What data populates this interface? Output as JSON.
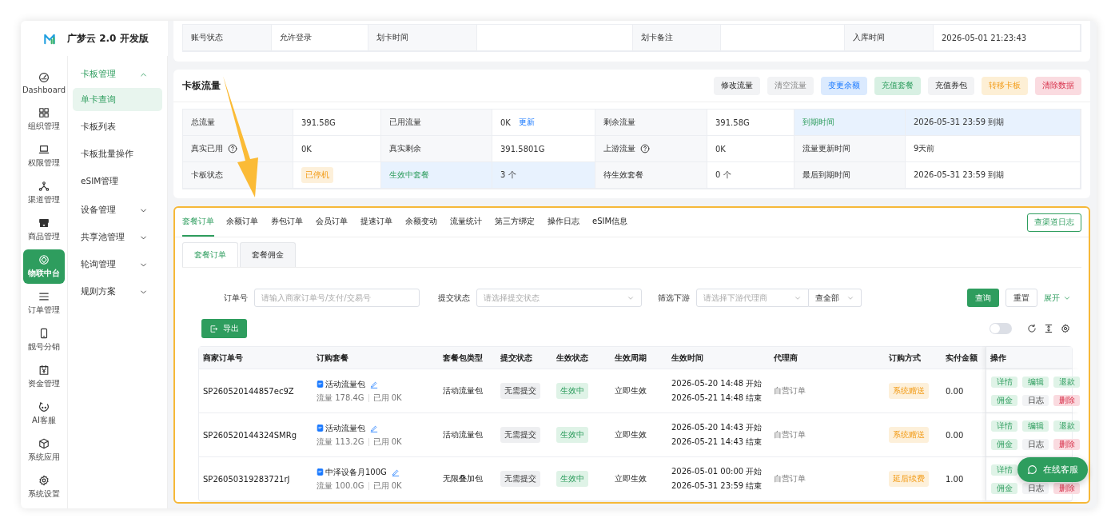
{
  "app": {
    "name": "广梦云 2.0 开发版"
  },
  "nav_rail": [
    {
      "label": "Dashboard",
      "selected": false
    },
    {
      "label": "组织管理",
      "selected": false
    },
    {
      "label": "权限管理",
      "selected": false
    },
    {
      "label": "渠道管理",
      "selected": false
    },
    {
      "label": "商品管理",
      "selected": false
    },
    {
      "label": "物联中台",
      "selected": true
    },
    {
      "label": "订单管理",
      "selected": false
    },
    {
      "label": "靓号分销",
      "selected": false
    },
    {
      "label": "资金管理",
      "selected": false
    },
    {
      "label": "AI客服",
      "selected": false
    },
    {
      "label": "系统应用",
      "selected": false
    },
    {
      "label": "系统设置",
      "selected": false
    }
  ],
  "submenu": [
    {
      "label": "卡板管理",
      "expanded": true,
      "children": [
        {
          "label": "单卡查询",
          "selected": true
        },
        {
          "label": "卡板列表",
          "selected": false
        },
        {
          "label": "卡板批量操作",
          "selected": false
        },
        {
          "label": "eSIM管理",
          "selected": false
        }
      ]
    },
    {
      "label": "设备管理",
      "expanded": false
    },
    {
      "label": "共享池管理",
      "expanded": false
    },
    {
      "label": "轮询管理",
      "expanded": false
    },
    {
      "label": "规则方案",
      "expanded": false
    }
  ],
  "account_row": [
    {
      "label": "账号状态",
      "value": "允许登录"
    },
    {
      "label": "划卡时间"
    },
    {
      "label": "划卡备注"
    },
    {
      "label": "入库时间",
      "value": "2026-05-01 21:23:43"
    }
  ],
  "traffic": {
    "title": "卡板流量",
    "buttons": [
      {
        "label": "修改流量",
        "kind": "default"
      },
      {
        "label": "清空流量",
        "kind": "muted"
      },
      {
        "label": "变更余额",
        "kind": "info"
      },
      {
        "label": "充值套餐",
        "kind": "success"
      },
      {
        "label": "充值券包",
        "kind": "default"
      },
      {
        "label": "转移卡板",
        "kind": "warning"
      },
      {
        "label": "清除数据",
        "kind": "danger"
      }
    ],
    "rows": [
      [
        {
          "label": "总流量",
          "value": "391.58G"
        },
        {
          "label": "已用流量",
          "value": "0K",
          "link": "更新"
        },
        {
          "label": "剩余流量",
          "value": "391.58G"
        },
        {
          "label": "到期时间",
          "value": "2026-05-31 23:59 到期",
          "highlight": true
        }
      ],
      [
        {
          "label": "真实已用",
          "help": true,
          "value": "0K"
        },
        {
          "label": "真实剩余",
          "value": "391.5801G"
        },
        {
          "label": "上游流量",
          "help": true,
          "value": "0K"
        },
        {
          "label": "流量更新时间",
          "value": "9天前"
        }
      ],
      [
        {
          "label": "卡板状态",
          "tag": "已停机"
        },
        {
          "label": "生效中套餐",
          "value": "3 个",
          "highlight": true
        },
        {
          "label": "待生效套餐",
          "value": "0 个"
        },
        {
          "label": "最后到期时间",
          "value": "2026-05-31 23:59 到期"
        }
      ]
    ]
  },
  "orders": {
    "tabs": [
      {
        "label": "套餐订单",
        "selected": true
      },
      {
        "label": "余额订单",
        "selected": false
      },
      {
        "label": "券包订单",
        "selected": false
      },
      {
        "label": "会员订单",
        "selected": false
      },
      {
        "label": "提速订单",
        "selected": false
      },
      {
        "label": "余额变动",
        "selected": false
      },
      {
        "label": "流量统计",
        "selected": false
      },
      {
        "label": "第三方绑定",
        "selected": false
      },
      {
        "label": "操作日志",
        "selected": false
      },
      {
        "label": "eSIM信息",
        "selected": false
      }
    ],
    "channel_log_button": "查渠道日志",
    "sub_tabs": [
      {
        "label": "套餐订单",
        "selected": true
      },
      {
        "label": "套餐佣金",
        "selected": false
      }
    ],
    "filters": [
      {
        "label": "订单号",
        "kind": "text",
        "placeholder": "请输入商家订单号/支付/交易号"
      },
      {
        "label": "提交状态",
        "kind": "select",
        "placeholder": "请选择提交状态"
      },
      {
        "label": "筛选下游",
        "kind": "select",
        "placeholder": "请选择下游代理商",
        "scope": "查全部"
      }
    ],
    "search_button": "查询",
    "reset_button": "重置",
    "expand_link": "展开",
    "export_button": "导出",
    "toggle": {
      "on": false
    },
    "table": {
      "columns": [
        "商家订单号",
        "订购套餐",
        "套餐包类型",
        "提交状态",
        "生效状态",
        "生效周期",
        "生效时间",
        "代理商",
        "订购方式",
        "实付金额",
        "操作"
      ],
      "rows": [
        {
          "order_no": "SP260520144857ec9Z",
          "package": {
            "name": "活动流量包",
            "flow": "流量 178.4G",
            "used": "已用 0K"
          },
          "type": "活动流量包",
          "submit": "无需提交",
          "effect": "生效中",
          "cycle": "立即生效",
          "start": "2026-05-20 14:48 开始",
          "end": "2026-05-21 14:48 结束",
          "agent": "自营订单",
          "method": {
            "text": "系统赠送",
            "kind": "warning"
          },
          "amount": "0.00",
          "actions": [
            {
              "label": "详情",
              "kind": "detail"
            },
            {
              "label": "编辑",
              "kind": "edit"
            },
            {
              "label": "退款",
              "kind": "refund"
            },
            {
              "label": "佣金",
              "kind": "commission"
            },
            {
              "label": "日志",
              "kind": "log"
            },
            {
              "label": "删除",
              "kind": "delete"
            }
          ]
        },
        {
          "order_no": "SP260520144324SMRg",
          "package": {
            "name": "活动流量包",
            "flow": "流量 113.2G",
            "used": "已用 0K"
          },
          "type": "活动流量包",
          "submit": "无需提交",
          "effect": "生效中",
          "cycle": "立即生效",
          "start": "2026-05-20 14:43 开始",
          "end": "2026-05-21 14:43 结束",
          "agent": "自营订单",
          "method": {
            "text": "系统赠送",
            "kind": "warning"
          },
          "amount": "0.00",
          "actions": [
            {
              "label": "详情",
              "kind": "detail"
            },
            {
              "label": "编辑",
              "kind": "edit"
            },
            {
              "label": "退款",
              "kind": "refund"
            },
            {
              "label": "佣金",
              "kind": "commission"
            },
            {
              "label": "日志",
              "kind": "log"
            },
            {
              "label": "删除",
              "kind": "delete"
            }
          ]
        },
        {
          "order_no": "SP26050319283721rJ",
          "package": {
            "name": "中泽设备月100G",
            "flow": "流量 100.0G",
            "used": "已用 0K"
          },
          "type": "无限叠加包",
          "submit": "无需提交",
          "effect": "生效中",
          "cycle": "立即生效",
          "start": "2026-05-01 00:00 开始",
          "end": "2026-05-31 23:59 结束",
          "agent": "自营订单",
          "method": {
            "text": "延后续费",
            "kind": "warning"
          },
          "amount": "1.00",
          "actions": [
            {
              "label": "详情",
              "kind": "detail"
            },
            {
              "label": "佣金",
              "kind": "commission"
            },
            {
              "label": "日志",
              "kind": "log"
            },
            {
              "label": "删除",
              "kind": "delete"
            }
          ]
        }
      ]
    }
  },
  "chat_button": "在线客服"
}
